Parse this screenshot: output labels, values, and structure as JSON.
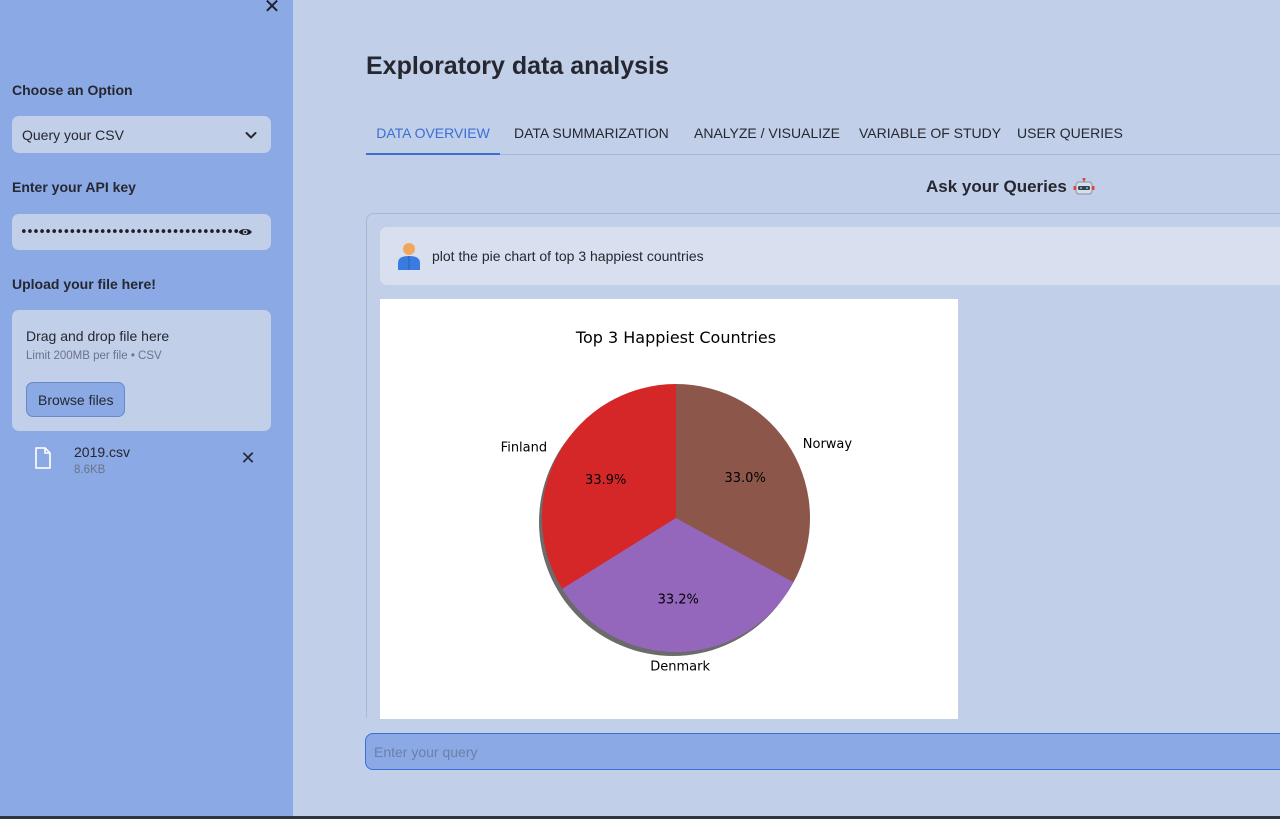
{
  "sidebar": {
    "close_icon": "close-icon",
    "option_label": "Choose an Option",
    "option_selected": "Query your CSV",
    "api_label": "Enter your API key",
    "api_value": "••••••••••••••••••••••••••••••••••••",
    "upload_label": "Upload your file here!",
    "dropzone_title": "Drag and drop file here",
    "dropzone_limit": "Limit 200MB per file • CSV",
    "browse_label": "Browse files",
    "file": {
      "name": "2019.csv",
      "size": "8.6KB"
    }
  },
  "main": {
    "title": "Exploratory data analysis",
    "tabs": [
      {
        "label": "DATA OVERVIEW",
        "active": true
      },
      {
        "label": "DATA SUMMARIZATION",
        "active": false
      },
      {
        "label": "ANALYZE / VISUALIZE",
        "active": false
      },
      {
        "label": "VARIABLE OF STUDY",
        "active": false
      },
      {
        "label": "USER QUERIES",
        "active": false
      }
    ],
    "queries_heading": "Ask your Queries",
    "user_message": "plot the pie chart of top 3 happiest countries",
    "query_placeholder": "Enter your query"
  },
  "colors": {
    "sidebar_bg": "#8aa9e5",
    "main_bg": "#c1cfe9",
    "accent": "#3b6fd6"
  },
  "chart_data": {
    "type": "pie",
    "title": "Top 3 Happiest Countries",
    "categories": [
      "Finland",
      "Denmark",
      "Norway"
    ],
    "values": [
      33.9,
      33.2,
      33.0
    ],
    "labels": [
      "33.9%",
      "33.2%",
      "33.0%"
    ],
    "colors": [
      "#d62728",
      "#9467bd",
      "#8c564b"
    ],
    "start_angle": 90,
    "shadow": true
  }
}
